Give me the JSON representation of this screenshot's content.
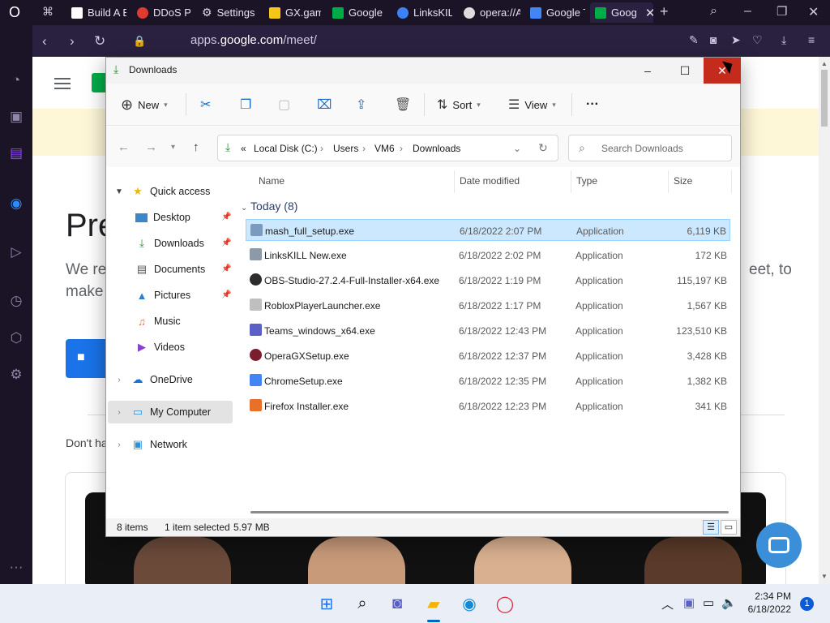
{
  "browser": {
    "tabs": [
      {
        "label": "Build A B",
        "color": "#ffffff"
      },
      {
        "label": "DDoS Pr",
        "color": "#e03b2f"
      },
      {
        "label": "Settings",
        "color": "#cccccc"
      },
      {
        "label": "GX.gam",
        "color": "#f5c518"
      },
      {
        "label": "Google M",
        "color": "#00ac47"
      },
      {
        "label": "LinksKILL",
        "color": "#3b82f6"
      },
      {
        "label": "opera://A",
        "color": "#dddddd"
      },
      {
        "label": "Google T",
        "color": "#4285f4"
      },
      {
        "label": "Goog",
        "color": "#00ac47",
        "active": true
      }
    ],
    "url_prefix": "apps.",
    "url_domain": "google.com",
    "url_path": "/meet/"
  },
  "webpage": {
    "hero_fragment": "Pre",
    "sub_line1": "We re",
    "sub_line1_end": "eet, to",
    "sub_line2": "make",
    "prompt_fragment": "Don't ha"
  },
  "explorer": {
    "title": "Downloads",
    "toolbar": {
      "new_label": "New",
      "sort_label": "Sort",
      "view_label": "View",
      "more_label": "···"
    },
    "path": [
      "Local Disk (C:)",
      "Users",
      "VM6",
      "Downloads"
    ],
    "path_overflow": "«",
    "search_placeholder": "Search Downloads",
    "nav": {
      "quick_access": "Quick access",
      "desktop": "Desktop",
      "downloads": "Downloads",
      "documents": "Documents",
      "pictures": "Pictures",
      "music": "Music",
      "videos": "Videos",
      "onedrive": "OneDrive",
      "my_computer": "My Computer",
      "network": "Network"
    },
    "columns": {
      "name": "Name",
      "date": "Date modified",
      "type": "Type",
      "size": "Size"
    },
    "group": "Today (8)",
    "files": [
      {
        "name": "mash_full_setup.exe",
        "date": "6/18/2022 2:07 PM",
        "type": "Application",
        "size": "6,119 KB",
        "selected": true,
        "icon_color": "#7a9bbd"
      },
      {
        "name": "LinksKILL New.exe",
        "date": "6/18/2022 2:02 PM",
        "type": "Application",
        "size": "172 KB",
        "icon_color": "#8c9aa8"
      },
      {
        "name": "OBS-Studio-27.2.4-Full-Installer-x64.exe",
        "date": "6/18/2022 1:19 PM",
        "type": "Application",
        "size": "115,197 KB",
        "icon_color": "#2d2d2d"
      },
      {
        "name": "RobloxPlayerLauncher.exe",
        "date": "6/18/2022 1:17 PM",
        "type": "Application",
        "size": "1,567 KB",
        "icon_color": "#bfbfbf"
      },
      {
        "name": "Teams_windows_x64.exe",
        "date": "6/18/2022 12:43 PM",
        "type": "Application",
        "size": "123,510 KB",
        "icon_color": "#5b5fc7"
      },
      {
        "name": "OperaGXSetup.exe",
        "date": "6/18/2022 12:37 PM",
        "type": "Application",
        "size": "3,428 KB",
        "icon_color": "#7a1e2e"
      },
      {
        "name": "ChromeSetup.exe",
        "date": "6/18/2022 12:35 PM",
        "type": "Application",
        "size": "1,382 KB",
        "icon_color": "#4285f4"
      },
      {
        "name": "Firefox Installer.exe",
        "date": "6/18/2022 12:23 PM",
        "type": "Application",
        "size": "341 KB",
        "icon_color": "#e8702a"
      }
    ],
    "status_count": "8 items",
    "status_selected": "1 item selected",
    "status_size": "5.97 MB"
  },
  "taskbar": {
    "time": "2:34 PM",
    "date": "6/18/2022",
    "notifications": "1"
  },
  "colors": {
    "close_red": "#c42b1c",
    "selection": "#cce8ff",
    "accent_blue": "#1b6bc4"
  }
}
